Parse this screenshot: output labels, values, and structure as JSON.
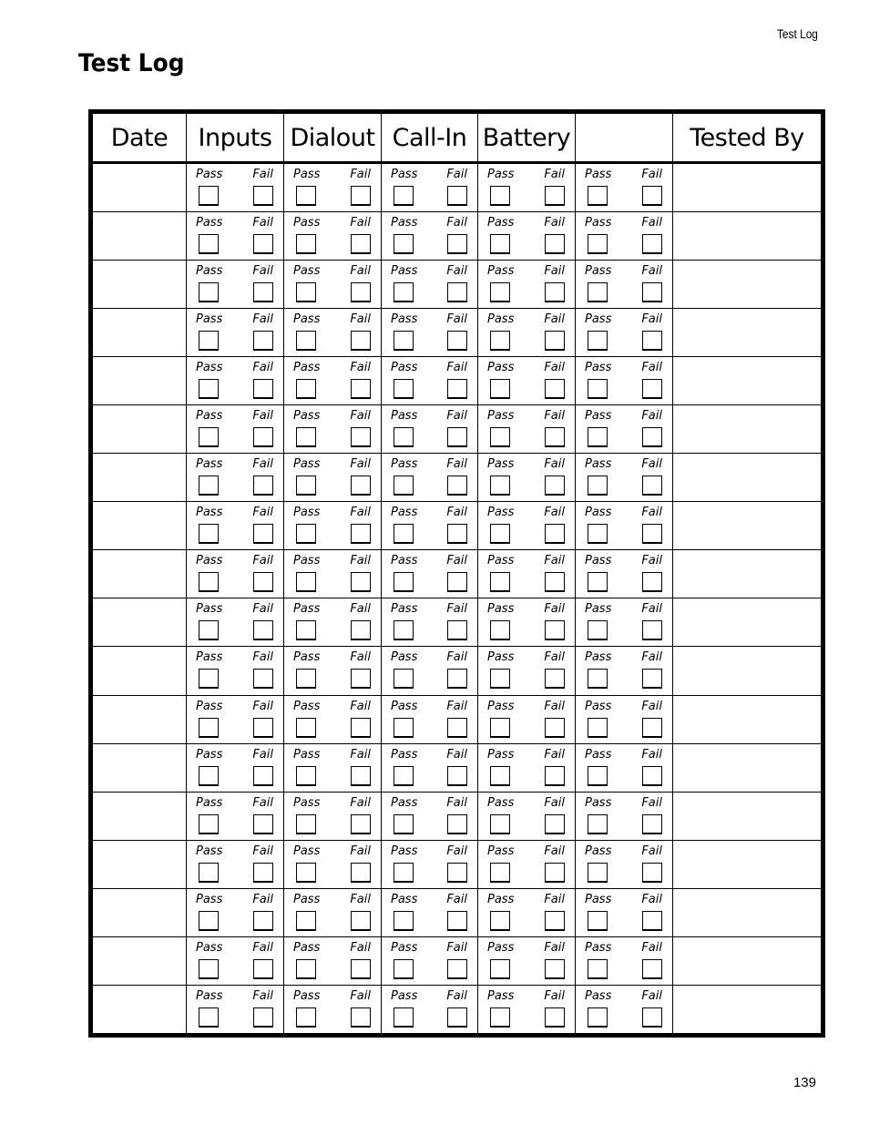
{
  "running_head": "Test Log",
  "page_title": "Test Log",
  "page_number": "139",
  "table": {
    "columns": [
      "Date",
      "Inputs",
      "Dialout",
      "Call-In",
      "Battery",
      "",
      "Tested By"
    ],
    "pass_label": "Pass",
    "fail_label": "Fail",
    "row_count": 18,
    "test_columns": [
      "Inputs",
      "Dialout",
      "Call-In",
      "Battery",
      ""
    ]
  }
}
